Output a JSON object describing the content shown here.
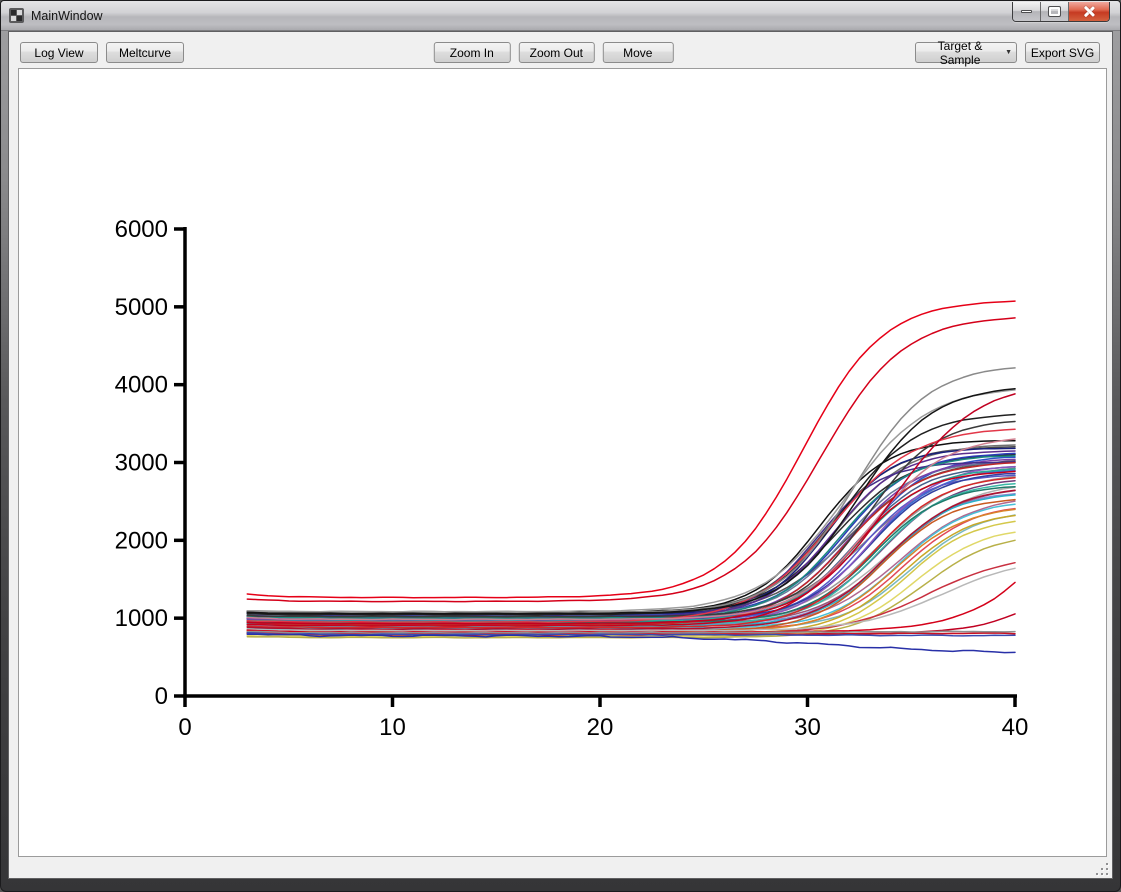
{
  "window": {
    "title": "MainWindow"
  },
  "toolbar": {
    "left": [
      {
        "label": "Log View"
      },
      {
        "label": "Meltcurve"
      }
    ],
    "center": [
      {
        "label": "Zoom In"
      },
      {
        "label": "Zoom Out"
      },
      {
        "label": "Move"
      }
    ],
    "right": [
      {
        "label": "Target & Sample",
        "type": "dropdown"
      },
      {
        "label": "Export SVG",
        "type": "button"
      }
    ]
  },
  "icons": {
    "dropdown_caret": "▼"
  },
  "chart_data": {
    "type": "line",
    "title": "",
    "xlabel": "",
    "ylabel": "",
    "xlim": [
      0,
      40
    ],
    "ylim": [
      0,
      6000
    ],
    "x_ticks": [
      0,
      10,
      20,
      30,
      40
    ],
    "y_ticks": [
      0,
      1000,
      2000,
      3000,
      4000,
      5000,
      6000
    ],
    "grid": false,
    "legend": "none",
    "axis_color": "#000000",
    "x_start": 3,
    "x_step": 0.5,
    "curve_model": "logistic (qPCR amplification curves: baseline -> sigmoid rise -> plateau)",
    "series": [
      {
        "color": "#101010",
        "baseline": 1075,
        "plateau": 3290,
        "midpoint": 30.6,
        "rate": 0.62
      },
      {
        "color": "#484848",
        "baseline": 1068,
        "plateau": 3210,
        "midpoint": 30.9,
        "rate": 0.6
      },
      {
        "color": "#6f6f6f",
        "baseline": 1010,
        "plateau": 3240,
        "midpoint": 31.4,
        "rate": 0.58
      },
      {
        "color": "#2c2c2c",
        "baseline": 1055,
        "plateau": 3120,
        "midpoint": 31.4,
        "rate": 0.55
      },
      {
        "color": "#555555",
        "baseline": 1040,
        "plateau": 3050,
        "midpoint": 32.0,
        "rate": 0.52
      },
      {
        "color": "#808080",
        "baseline": 995,
        "plateau": 2980,
        "midpoint": 32.8,
        "rate": 0.5
      },
      {
        "color": "#9a9a9a",
        "baseline": 965,
        "plateau": 2870,
        "midpoint": 33.4,
        "rate": 0.55
      },
      {
        "color": "#b0b0b0",
        "baseline": 935,
        "plateau": 2760,
        "midpoint": 34.0,
        "rate": 0.52
      },
      {
        "color": "#18207c",
        "baseline": 1045,
        "plateau": 3190,
        "midpoint": 31.0,
        "rate": 0.65
      },
      {
        "color": "#2a3bb8",
        "baseline": 1035,
        "plateau": 3130,
        "midpoint": 31.8,
        "rate": 0.6
      },
      {
        "color": "#2f52c8",
        "baseline": 990,
        "plateau": 3090,
        "midpoint": 32.6,
        "rate": 0.62
      },
      {
        "color": "#3b6bd6",
        "baseline": 975,
        "plateau": 2930,
        "midpoint": 33.0,
        "rate": 0.6
      },
      {
        "color": "#5858c8",
        "baseline": 970,
        "plateau": 2850,
        "midpoint": 32.6,
        "rate": 0.64
      },
      {
        "color": "#8888d0",
        "baseline": 912,
        "plateau": 2640,
        "midpoint": 33.8,
        "rate": 0.6
      },
      {
        "color": "#6a7a9a",
        "baseline": 1025,
        "plateau": 3020,
        "midpoint": 31.8,
        "rate": 0.6
      },
      {
        "color": "#46608a",
        "baseline": 1010,
        "plateau": 2960,
        "midpoint": 32.4,
        "rate": 0.62
      },
      {
        "color": "#303f9f",
        "baseline": 985,
        "plateau": 2890,
        "midpoint": 33.0,
        "rate": 0.6
      },
      {
        "color": "#5a2d8e",
        "baseline": 1005,
        "plateau": 3160,
        "midpoint": 31.2,
        "rate": 0.6
      },
      {
        "color": "#7a3fa8",
        "baseline": 970,
        "plateau": 3060,
        "midpoint": 32.0,
        "rate": 0.58
      },
      {
        "color": "#8a58c0",
        "baseline": 940,
        "plateau": 2980,
        "midpoint": 33.0,
        "rate": 0.6
      },
      {
        "color": "#452f8a",
        "baseline": 1020,
        "plateau": 3010,
        "midpoint": 30.4,
        "rate": 0.65
      },
      {
        "color": "#703a78",
        "baseline": 955,
        "plateau": 2810,
        "midpoint": 33.6,
        "rate": 0.58
      },
      {
        "color": "#985878",
        "baseline": 925,
        "plateau": 2700,
        "midpoint": 34.0,
        "rate": 0.56
      },
      {
        "color": "#b06890",
        "baseline": 890,
        "plateau": 2580,
        "midpoint": 34.4,
        "rate": 0.54
      },
      {
        "color": "#1b8a80",
        "baseline": 1000,
        "plateau": 3100,
        "midpoint": 31.6,
        "rate": 0.6
      },
      {
        "color": "#2aa898",
        "baseline": 960,
        "plateau": 2940,
        "midpoint": 32.4,
        "rate": 0.58
      },
      {
        "color": "#39b8a8",
        "baseline": 920,
        "plateau": 2760,
        "midpoint": 33.4,
        "rate": 0.6
      },
      {
        "color": "#1f7a6a",
        "baseline": 945,
        "plateau": 2720,
        "midpoint": 33.2,
        "rate": 0.6
      },
      {
        "color": "#2ab0c8",
        "baseline": 900,
        "plateau": 2620,
        "midpoint": 33.8,
        "rate": 0.62
      },
      {
        "color": "#48c0d8",
        "baseline": 870,
        "plateau": 2520,
        "midpoint": 34.4,
        "rate": 0.6
      },
      {
        "color": "#78b8c0",
        "baseline": 858,
        "plateau": 2400,
        "midpoint": 35.0,
        "rate": 0.6
      },
      {
        "color": "#c8001c",
        "baseline": 905,
        "plateau": 2900,
        "midpoint": 32.2,
        "rate": 0.6
      },
      {
        "color": "#d62828",
        "baseline": 880,
        "plateau": 2840,
        "midpoint": 33.2,
        "rate": 0.58
      },
      {
        "color": "#b01030",
        "baseline": 860,
        "plateau": 2700,
        "midpoint": 33.8,
        "rate": 0.56
      },
      {
        "color": "#c02828",
        "baseline": 918,
        "plateau": 3020,
        "midpoint": 31.9,
        "rate": 0.55
      },
      {
        "color": "#e04858",
        "baseline": 840,
        "plateau": 2480,
        "midpoint": 34.6,
        "rate": 0.58
      },
      {
        "color": "#c85a20",
        "baseline": 830,
        "plateau": 2560,
        "midpoint": 33.6,
        "rate": 0.6
      },
      {
        "color": "#d88428",
        "baseline": 815,
        "plateau": 2450,
        "midpoint": 34.2,
        "rate": 0.58
      },
      {
        "color": "#c8a828",
        "baseline": 795,
        "plateau": 2380,
        "midpoint": 34.6,
        "rate": 0.6
      },
      {
        "color": "#d4c84a",
        "baseline": 780,
        "plateau": 2300,
        "midpoint": 34.8,
        "rate": 0.62
      },
      {
        "color": "#e0d868",
        "baseline": 765,
        "plateau": 2180,
        "midpoint": 35.2,
        "rate": 0.6
      },
      {
        "color": "#b8b048",
        "baseline": 750,
        "plateau": 2100,
        "midpoint": 35.6,
        "rate": 0.58
      },
      {
        "color": "#c83040",
        "baseline": 800,
        "plateau": 1820,
        "midpoint": 35.8,
        "rate": 0.5
      },
      {
        "color": "#b8b8b8",
        "baseline": 838,
        "plateau": 1780,
        "midpoint": 36.5,
        "rate": 0.5
      },
      {
        "color": "#d40019",
        "baseline": 820,
        "plateau": 5000,
        "midpoint": 43.8,
        "rate": 0.45
      },
      {
        "color": "#c00021",
        "baseline": 792,
        "plateau": 3200,
        "midpoint": 44.2,
        "rate": 0.5
      },
      {
        "color": "#cc1022",
        "baseline": 788,
        "plateau": 806,
        "midpoint": 30.0,
        "rate": 0.4,
        "noise": 6
      },
      {
        "color": "#8f8f8f",
        "baseline": 812,
        "plateau": 828,
        "midpoint": 30.0,
        "rate": 0.4,
        "noise": 6
      },
      {
        "color": "#3a4ab0",
        "baseline": 790,
        "plateau": 776,
        "midpoint": 30.0,
        "rate": 0.3,
        "noise": 7
      },
      {
        "color": "#2830a8",
        "baseline": 775,
        "plateau": 545,
        "midpoint": 31.0,
        "rate": 0.28,
        "noise": 15
      },
      {
        "color": "#202020",
        "baseline": 1045,
        "plateau": 3640,
        "midpoint": 31.6,
        "rate": 0.55
      },
      {
        "color": "#3a3a3a",
        "baseline": 1020,
        "plateau": 3560,
        "midpoint": 32.8,
        "rate": 0.6
      },
      {
        "color": "#e23748",
        "baseline": 950,
        "plateau": 3460,
        "midpoint": 31.2,
        "rate": 0.5
      },
      {
        "color": "#cf8090",
        "baseline": 985,
        "plateau": 3350,
        "midpoint": 33.0,
        "rate": 0.55
      },
      {
        "color": "#8a8a8a",
        "baseline": 1070,
        "plateau": 4260,
        "midpoint": 32.2,
        "rate": 0.55
      },
      {
        "color": "#9c9c9c",
        "baseline": 1085,
        "plateau": 3980,
        "midpoint": 31.8,
        "rate": 0.5
      },
      {
        "color": "#141414",
        "baseline": 1060,
        "plateau": 3990,
        "midpoint": 32.4,
        "rate": 0.55
      },
      {
        "color": "#c00021",
        "baseline": 930,
        "plateau": 4050,
        "midpoint": 34.0,
        "rate": 0.48
      },
      {
        "color": "#d40019",
        "baseline": 1215,
        "plateau": 4890,
        "midpoint": 30.6,
        "rate": 0.5,
        "start_bump": 30
      },
      {
        "color": "#e60017",
        "baseline": 1265,
        "plateau": 5090,
        "midpoint": 29.8,
        "rate": 0.52,
        "start_bump": 45
      }
    ]
  }
}
